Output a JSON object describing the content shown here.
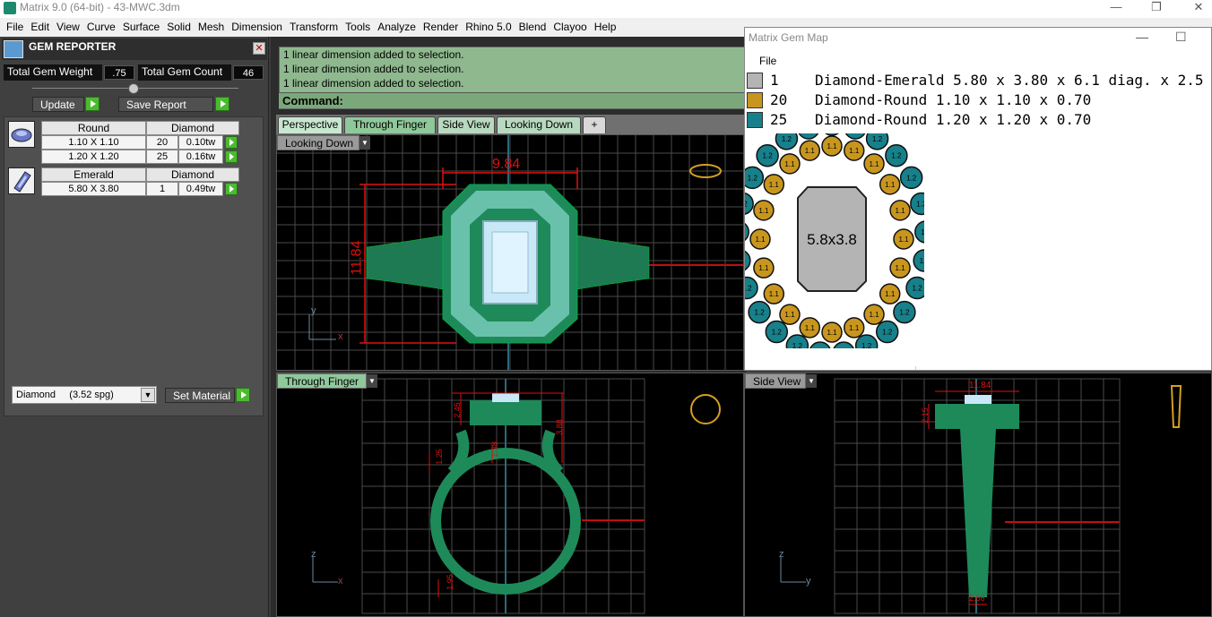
{
  "title_bar": {
    "text": "Matrix 9.0 (64-bit) - 43-MWC.3dm",
    "minimize": "—",
    "maximize": "❐",
    "close": "✕"
  },
  "menu": [
    "File",
    "Edit",
    "View",
    "Curve",
    "Surface",
    "Solid",
    "Mesh",
    "Dimension",
    "Transform",
    "Tools",
    "Analyze",
    "Render",
    "Rhino 5.0",
    "Blend",
    "Clayoo",
    "Help"
  ],
  "gem_reporter": {
    "title": "GEM REPORTER",
    "close": "✕",
    "total_weight_label": "Total Gem Weight",
    "total_weight": ".75",
    "total_count_label": "Total Gem Count",
    "total_count": "46",
    "update_label": "Update",
    "save_label": "Save Report",
    "groups": [
      {
        "shape": "Round",
        "material": "Diamond",
        "rows": [
          {
            "size": "1.10 X 1.10",
            "qty": "20",
            "weight": "0.10tw"
          },
          {
            "size": "1.20 X 1.20",
            "qty": "25",
            "weight": "0.16tw"
          }
        ]
      },
      {
        "shape": "Emerald",
        "material": "Diamond",
        "rows": [
          {
            "size": "5.80 X 3.80",
            "qty": "1",
            "weight": "0.49tw"
          }
        ]
      }
    ],
    "material_select": "Diamond     (3.52 spg)",
    "set_material_label": "Set Material"
  },
  "command": {
    "lines": [
      "1 linear dimension added to selection.",
      "1 linear dimension added to selection.",
      "1 linear dimension added to selection."
    ],
    "prompt": "Command:"
  },
  "view_tabs": [
    "Perspective",
    "Through Finger",
    "Side View",
    "Looking Down",
    "+"
  ],
  "viewports": {
    "top": {
      "label": "Looking Down",
      "dim_width": "9.84",
      "dim_height": "11.84",
      "axis_y": "y",
      "axis_x": "x"
    },
    "front": {
      "label": "Through Finger",
      "dims": [
        "2.45",
        "3.88",
        "1.25",
        "1.38",
        "1.95"
      ],
      "axis_z": "z",
      "axis_x": "x"
    },
    "side": {
      "label": "Side View",
      "dims": [
        "11.84",
        "2.15",
        "2.66"
      ],
      "axis_z": "z",
      "axis_y": "y"
    }
  },
  "gem_map": {
    "title": "Matrix Gem Map",
    "menu_file": "File",
    "rows": [
      {
        "count": "1",
        "desc": "Diamond-Emerald 5.80 x 3.80 x 6.1 diag. x 2.5",
        "color": "#b4b4b4"
      },
      {
        "count": "20",
        "desc": "Diamond-Round 1.10 x 1.10 x 0.70",
        "color": "#c8961e"
      },
      {
        "count": "25",
        "desc": "Diamond-Round 1.20 x 1.20 x 0.70",
        "color": "#17808a"
      }
    ],
    "center_label": "5.8x3.8",
    "outer_label": "1.2",
    "inner_label": "1.1"
  },
  "colors": {
    "ring": "#1e8a5a",
    "dimension": "#e01010",
    "grid": "#555555",
    "outer_gem": "#17808a",
    "inner_gem": "#c8961e"
  }
}
